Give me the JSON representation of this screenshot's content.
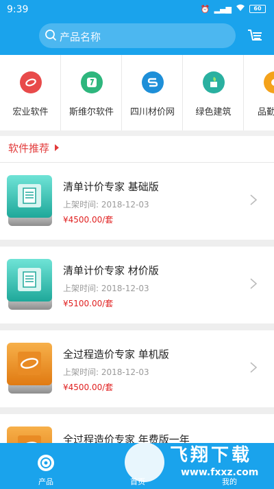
{
  "status_bar": {
    "time": "9:39",
    "battery": "60"
  },
  "search": {
    "placeholder": "产品名称"
  },
  "categories": [
    {
      "label": "宏业软件",
      "icon": "hongye-logo-icon",
      "color": "#e84a4a"
    },
    {
      "label": "斯维尔软件",
      "icon": "siweier-logo-icon",
      "color": "#2eb67d"
    },
    {
      "label": "四川材价网",
      "icon": "sichuan-logo-icon",
      "color": "#1e8fd8"
    },
    {
      "label": "绿色建筑",
      "icon": "green-building-icon",
      "color": "#2ab0a0"
    },
    {
      "label": "品勤",
      "icon": "pinqin-logo-icon",
      "color": "#f4a21a"
    }
  ],
  "section": {
    "title": "软件推荐"
  },
  "products": [
    {
      "title": "清单计价专家 基础版",
      "date": "上架时间: 2018-12-03",
      "price": "¥4500.00/套",
      "color": "teal"
    },
    {
      "title": "清单计价专家 材价版",
      "date": "上架时间: 2018-12-03",
      "price": "¥5100.00/套",
      "color": "teal"
    },
    {
      "title": "全过程造价专家 单机版",
      "date": "上架时间: 2018-12-03",
      "price": "¥4500.00/套",
      "color": "orange"
    },
    {
      "title": "全过程造价专家 年费版一年",
      "date": "",
      "price": "",
      "color": "orange"
    }
  ],
  "tabs": [
    {
      "label": "产品"
    },
    {
      "label": "首页"
    },
    {
      "label": "我的"
    }
  ],
  "watermark": {
    "title": "飞翔下载",
    "url": "www.fxxz.com"
  },
  "colors": {
    "brand": "#1aa3ec",
    "price": "#e01f1f",
    "section": "#e23a3a"
  }
}
